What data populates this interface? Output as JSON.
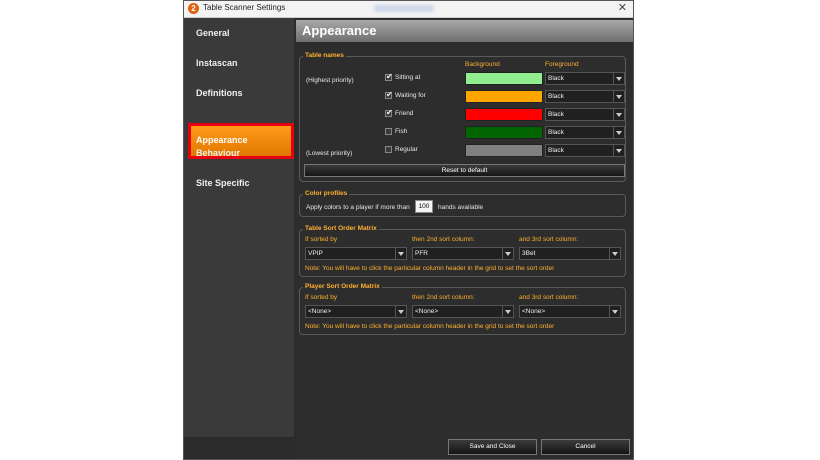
{
  "window": {
    "title": "Table Scanner Settings",
    "logo_text": "2"
  },
  "sidebar": {
    "items": [
      {
        "label": "General"
      },
      {
        "label": "Instascan"
      },
      {
        "label": "Definitions"
      },
      {
        "label": "Appearance"
      },
      {
        "label": "Behaviour"
      },
      {
        "label": "Site Specific"
      }
    ],
    "active_index": 3
  },
  "header": {
    "title": "Appearance"
  },
  "table_names": {
    "title": "Table names",
    "col_background": "Background",
    "col_foreground": "Foreground",
    "highest_label": "(Highest priority)",
    "lowest_label": "(Lowest priority)",
    "rows": [
      {
        "label": "Sitting at",
        "checked": true,
        "color": "#90ee90",
        "foreground": "Black"
      },
      {
        "label": "Waiting for",
        "checked": true,
        "color": "#ffa500",
        "foreground": "Black"
      },
      {
        "label": "Friend",
        "checked": true,
        "color": "#ff0000",
        "foreground": "Black"
      },
      {
        "label": "Fish",
        "checked": false,
        "color": "#006400",
        "foreground": "Black"
      },
      {
        "label": "Regular",
        "checked": false,
        "color": "#808080",
        "foreground": "Black"
      }
    ],
    "reset_label": "Reset to default"
  },
  "color_profiles": {
    "title": "Color profiles",
    "prefix": "Apply colors to a player if more than",
    "value": "100",
    "suffix": "hands available"
  },
  "table_sort": {
    "title": "Table Sort Order Matrix",
    "col1": "If sorted by",
    "col2": "then 2nd sort column:",
    "col3": "and 3rd sort column:",
    "v1": "VPIP",
    "v2": "PFR",
    "v3": "3Bet",
    "note": "Note: You will have to click the particular column header in the grid to set the sort order"
  },
  "player_sort": {
    "title": "Player Sort Order Matrix",
    "col1": "If sorted by",
    "col2": "then 2nd sort column:",
    "col3": "and 3rd sort column:",
    "v1": "<None>",
    "v2": "<None>",
    "v3": "<None>",
    "note": "Note: You will have to click the particular column header in the grid to set the sort order"
  },
  "footer": {
    "save_label": "Save and Close",
    "cancel_label": "Cancel"
  }
}
